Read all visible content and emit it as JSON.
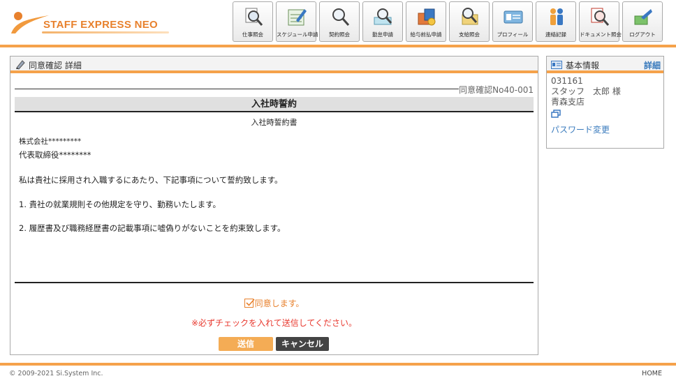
{
  "header": {
    "logo_text": "STAFF EXPRESS NEO",
    "nav": [
      {
        "label": "仕事照会",
        "icon": "job-search-icon"
      },
      {
        "label": "スケジュール申請",
        "icon": "schedule-icon"
      },
      {
        "label": "契約照会",
        "icon": "contract-search-icon"
      },
      {
        "label": "勤怠申請",
        "icon": "attendance-icon"
      },
      {
        "label": "給与前払申請",
        "icon": "advance-pay-icon"
      },
      {
        "label": "支給照会",
        "icon": "payment-icon"
      },
      {
        "label": "プロフィール",
        "icon": "profile-card-icon"
      },
      {
        "label": "連絡記録",
        "icon": "contact-people-icon"
      },
      {
        "label": "ドキュメント照会",
        "icon": "document-search-icon"
      },
      {
        "label": "ログアウト",
        "icon": "logout-icon"
      }
    ]
  },
  "main": {
    "panel_title": "同意確認 詳細",
    "doc_no": "同意確認No40-001",
    "doc_title": "入社時誓約",
    "doc_subtitle": "入社時誓約書",
    "body": {
      "company": "株式会社*********",
      "representative": "代表取締役********",
      "para1": "私は貴社に採用され入職するにあたり、下記事項について誓約致します。",
      "item1": "1. 貴社の就業規則その他規定を守り、勤務いたします。",
      "item2": "2. 履歴書及び職務経歴書の記載事項に嘘偽りがないことを約束致します。"
    },
    "agree_label": "同意します。",
    "agree_checked": true,
    "warning": "※必ずチェックを入れて送信してください。",
    "send_label": "送信",
    "cancel_label": "キャンセル"
  },
  "side": {
    "title": "基本情報",
    "detail_link": "詳細",
    "staff_id": "031161",
    "staff_name": "スタッフ　太郎 様",
    "branch": "青森支店",
    "password_link": "パスワード変更"
  },
  "footer": {
    "copyright": "© 2009-2021 Si.System Inc.",
    "home": "HOME"
  },
  "colors": {
    "accent": "#f5a24b",
    "link": "#3a7bbd",
    "warning": "#e8382e"
  }
}
